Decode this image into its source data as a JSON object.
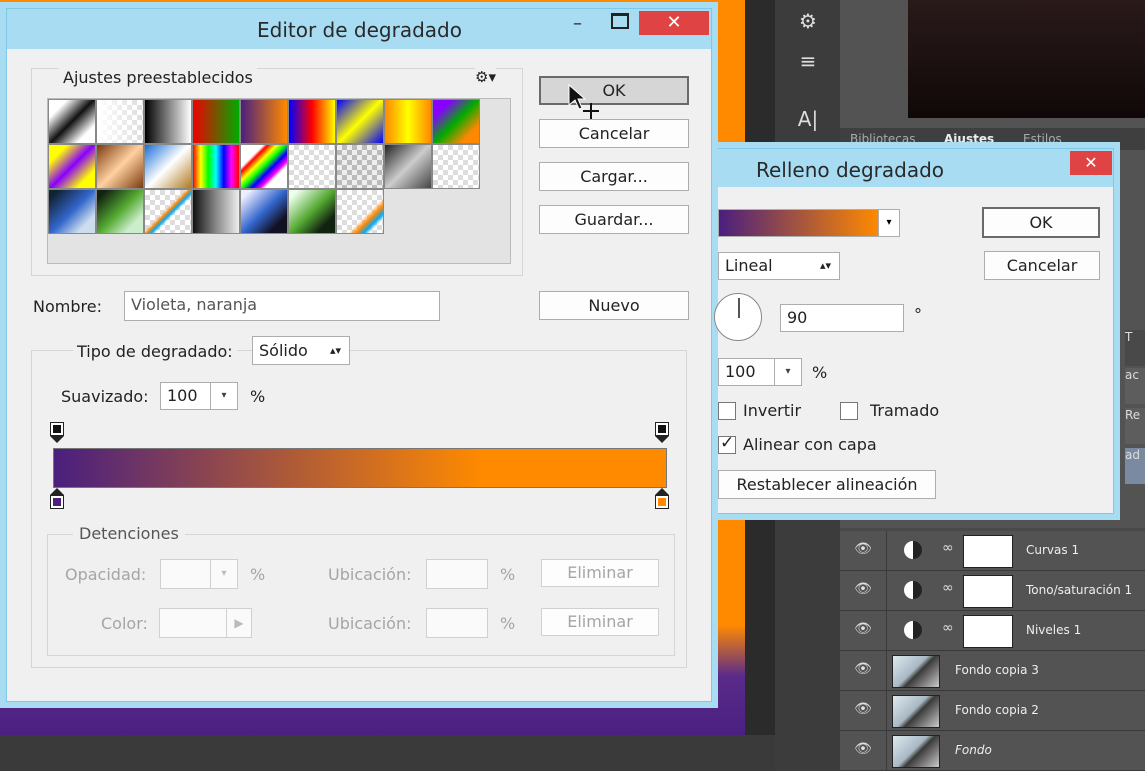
{
  "photoshop": {
    "panel_tabs": [
      "Bibliotecas",
      "Ajustes",
      "Estilos"
    ],
    "layers": [
      {
        "name": "Curvas 1",
        "kind": "adjustment"
      },
      {
        "name": "Tono/saturación 1",
        "kind": "adjustment"
      },
      {
        "name": "Niveles 1",
        "kind": "adjustment"
      },
      {
        "name": "Fondo copia 3",
        "kind": "image"
      },
      {
        "name": "Fondo copia 2",
        "kind": "image"
      },
      {
        "name": "Fondo",
        "kind": "image"
      }
    ],
    "side_letters": [
      "T",
      "ac",
      "Re",
      "ad"
    ]
  },
  "gradient_editor": {
    "title": "Editor de degradado",
    "presets_label": "Ajustes preestablecidos",
    "buttons": {
      "ok": "OK",
      "cancel": "Cancelar",
      "load": "Cargar...",
      "save": "Guardar...",
      "new": "Nuevo"
    },
    "name_label": "Nombre:",
    "name_value": "Violeta, naranja",
    "type_label": "Tipo de degradado:",
    "type_value": "Sólido",
    "smoothness_label": "Suavizado:",
    "smoothness_value": "100",
    "percent": "%",
    "gradient_colors": [
      "#4a1f7e",
      "#ff8a00"
    ],
    "stops_section": {
      "label": "Detenciones",
      "opacity_label": "Opacidad:",
      "location_label": "Ubicación:",
      "color_label": "Color:",
      "delete_label": "Eliminar"
    },
    "presets": [
      [
        "bw-diag",
        "trans-white",
        "black-white",
        "red-green",
        "violet-orange",
        "blue-red-yellow",
        "blue-yellow-blue",
        "orange-yellow",
        "violet-green-orange"
      ],
      [
        "yellow-violet",
        "copper",
        "chrome",
        "spectrum",
        "rainbow-diag",
        "trans-rainbow",
        "checker-trans",
        "metal",
        "checker-trans2"
      ],
      [
        "blue-steel",
        "green",
        "trans-stripes",
        "dark-metal",
        "blue-dark",
        "green-dark",
        "trans-rainbow2"
      ]
    ]
  },
  "gradient_fill": {
    "title": "Relleno degradado",
    "ok": "OK",
    "cancel": "Cancelar",
    "style_value": "Lineal",
    "angle_value": "90",
    "degree_symbol": "°",
    "scale_value": "100",
    "percent": "%",
    "reverse_label": "Invertir",
    "dither_label": "Tramado",
    "align_label": "Alinear con capa",
    "reset_label": "Restablecer alineación",
    "reverse_checked": false,
    "dither_checked": false,
    "align_checked": true
  }
}
